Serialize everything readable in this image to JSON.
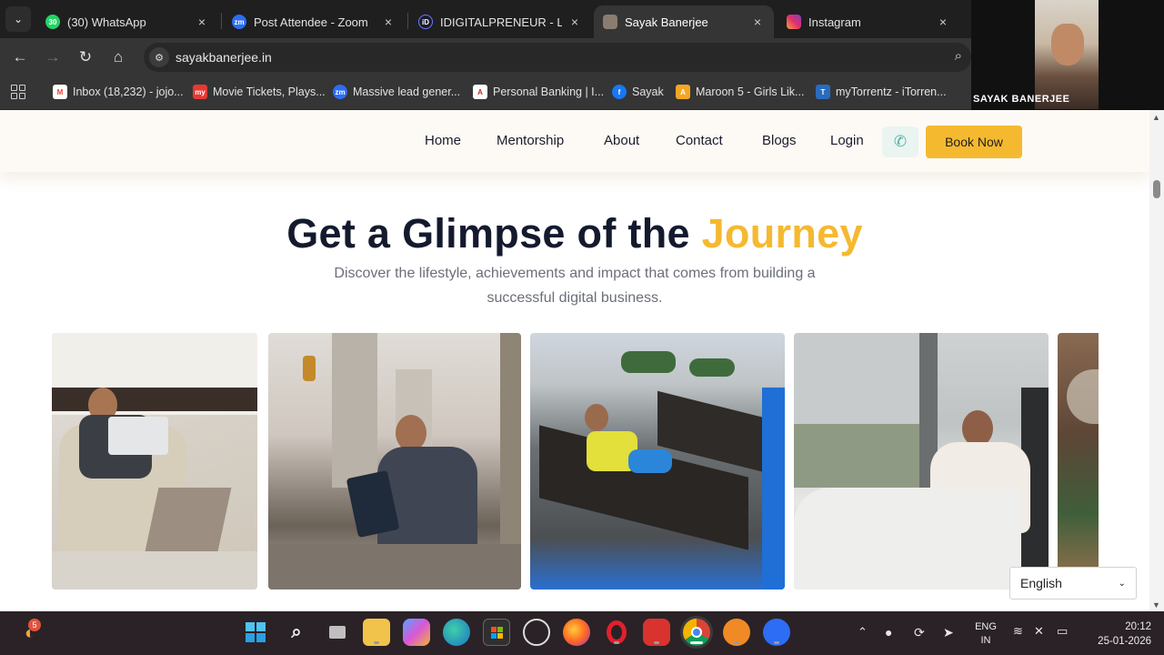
{
  "browser": {
    "tabs": [
      {
        "title": "(30) WhatsApp",
        "favicon_text": "30",
        "color": "#25d366",
        "active": false
      },
      {
        "title": "Post Attendee - Zoom",
        "favicon_text": "zm",
        "color": "#2d6cf5",
        "active": false
      },
      {
        "title": "IDIGITALPRENEUR - Learn",
        "favicon_text": "iD",
        "color": "#1a1a2e",
        "active": false
      },
      {
        "title": "Sayak Banerjee",
        "favicon_text": "",
        "color": "#8a7d70",
        "active": true
      },
      {
        "title": "Instagram",
        "favicon_text": "",
        "color": "#e1306c",
        "active": false
      }
    ],
    "close_glyph": "×",
    "url": "sayakbanerjee.in",
    "bookmarks": [
      {
        "label": "Inbox (18,232) - jojo...",
        "favicon_text": "M",
        "color": "#ea4335"
      },
      {
        "label": "Movie Tickets, Plays...",
        "favicon_text": "my",
        "color": "#e53935"
      },
      {
        "label": "Massive lead gener...",
        "favicon_text": "zm",
        "color": "#2d6cf5"
      },
      {
        "label": "Personal Banking | I...",
        "favicon_text": "A",
        "color": "#c62828"
      },
      {
        "label": "Sayak",
        "favicon_text": "f",
        "color": "#1877f2"
      },
      {
        "label": "Maroon 5 - Girls Lik...",
        "favicon_text": "A",
        "color": "#f5a623"
      },
      {
        "label": "myTorrentz - iTorren...",
        "favicon_text": "T",
        "color": "#2a6bbf"
      }
    ]
  },
  "video_overlay": {
    "name": "SAYAK BANERJEE"
  },
  "site": {
    "nav": [
      "Home",
      "Mentorship",
      "About",
      "Contact",
      "Blogs",
      "Login"
    ],
    "phone_icon": "✆",
    "cta": "Book Now",
    "heading_main": "Get a Glimpse of the ",
    "heading_accent": "Journey",
    "subheading": "Discover the lifestyle, achievements and impact that comes from building a successful digital business.",
    "language": "English",
    "accent_color": "#f5b930"
  },
  "taskbar": {
    "weather_badge": "5",
    "lang_line1": "ENG",
    "lang_line2": "IN",
    "time": "20:12",
    "date": "25-01-2026"
  }
}
